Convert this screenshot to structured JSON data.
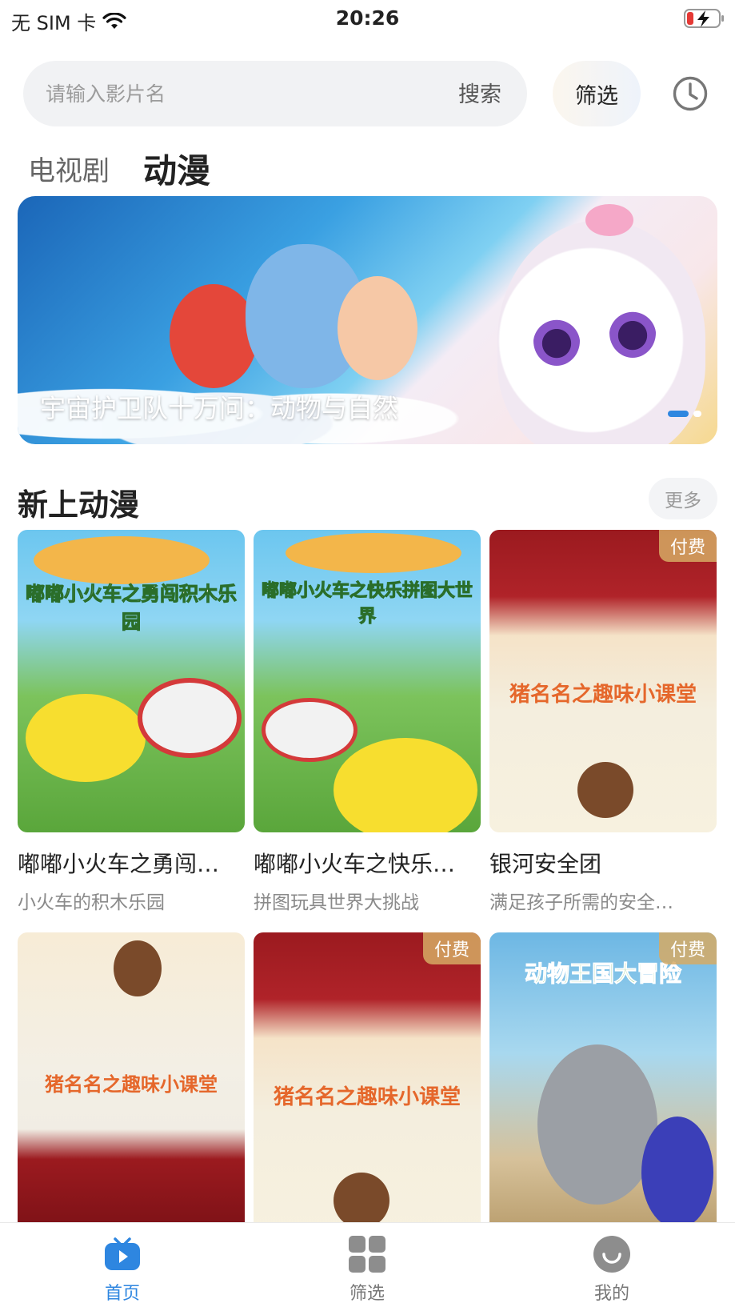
{
  "status_bar": {
    "carrier": "无 SIM 卡",
    "time": "20:26",
    "icons": [
      "wifi-icon",
      "battery-charging-icon"
    ]
  },
  "search": {
    "placeholder": "请输入影片名",
    "button_label": "搜索"
  },
  "filter_button": "筛选",
  "history_icon": "clock-icon",
  "tabs": [
    {
      "label": "电视剧",
      "active": false
    },
    {
      "label": "动漫",
      "active": true
    }
  ],
  "banner": {
    "title": "宇宙护卫队十万问：动物与自然",
    "slides_count": 2,
    "active_slide": 1
  },
  "section": {
    "title": "新上动漫",
    "more_label": "更多"
  },
  "cards": [
    {
      "title": "嘟嘟小火车之勇闯积木乐园",
      "display_title": "嘟嘟小火车之勇闯…",
      "subtitle": "小火车的积木乐园",
      "paid": false,
      "poster_text": "嘟嘟小火车之勇闯积木乐园"
    },
    {
      "title": "嘟嘟小火车之快乐拼图大世界",
      "display_title": "嘟嘟小火车之快乐…",
      "subtitle": "拼图玩具世界大挑战",
      "paid": false,
      "poster_text": "嘟嘟小火车之快乐拼图大世界"
    },
    {
      "title": "银河安全团",
      "display_title": "银河安全团",
      "subtitle": "满足孩子所需的安全…",
      "paid": true,
      "paid_label": "付费",
      "poster_text": "猪名名之趣味小课堂"
    },
    {
      "paid": false,
      "poster_text": "猪名名之趣味小课堂"
    },
    {
      "paid": true,
      "paid_label": "付费",
      "poster_text": "猪名名之趣味小课堂"
    },
    {
      "paid": true,
      "paid_label": "付费",
      "poster_text": "动物王国大冒险"
    }
  ],
  "bottom_nav": [
    {
      "label": "首页",
      "icon": "tv-play-icon",
      "active": true
    },
    {
      "label": "筛选",
      "icon": "grid-icon",
      "active": false
    },
    {
      "label": "我的",
      "icon": "smile-icon",
      "active": false
    }
  ],
  "colors": {
    "accent": "#2e86e0",
    "paid_badge": "#d6aa64",
    "text_primary": "#222222",
    "text_secondary": "#8a8a8a"
  }
}
